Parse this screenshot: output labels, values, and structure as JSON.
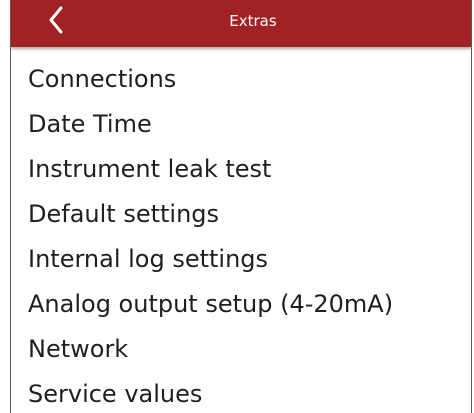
{
  "colors": {
    "header_background": "#a12224",
    "header_text": "#ffffff",
    "item_text": "#1f1f1f"
  },
  "header": {
    "title": "Extras",
    "back_icon": "chevron-left-icon"
  },
  "menu": {
    "items": [
      {
        "label": "Connections"
      },
      {
        "label": "Date Time"
      },
      {
        "label": "Instrument leak test"
      },
      {
        "label": "Default settings"
      },
      {
        "label": "Internal log settings"
      },
      {
        "label": "Analog output setup (4-20mA)"
      },
      {
        "label": "Network"
      },
      {
        "label": "Service values"
      }
    ]
  }
}
